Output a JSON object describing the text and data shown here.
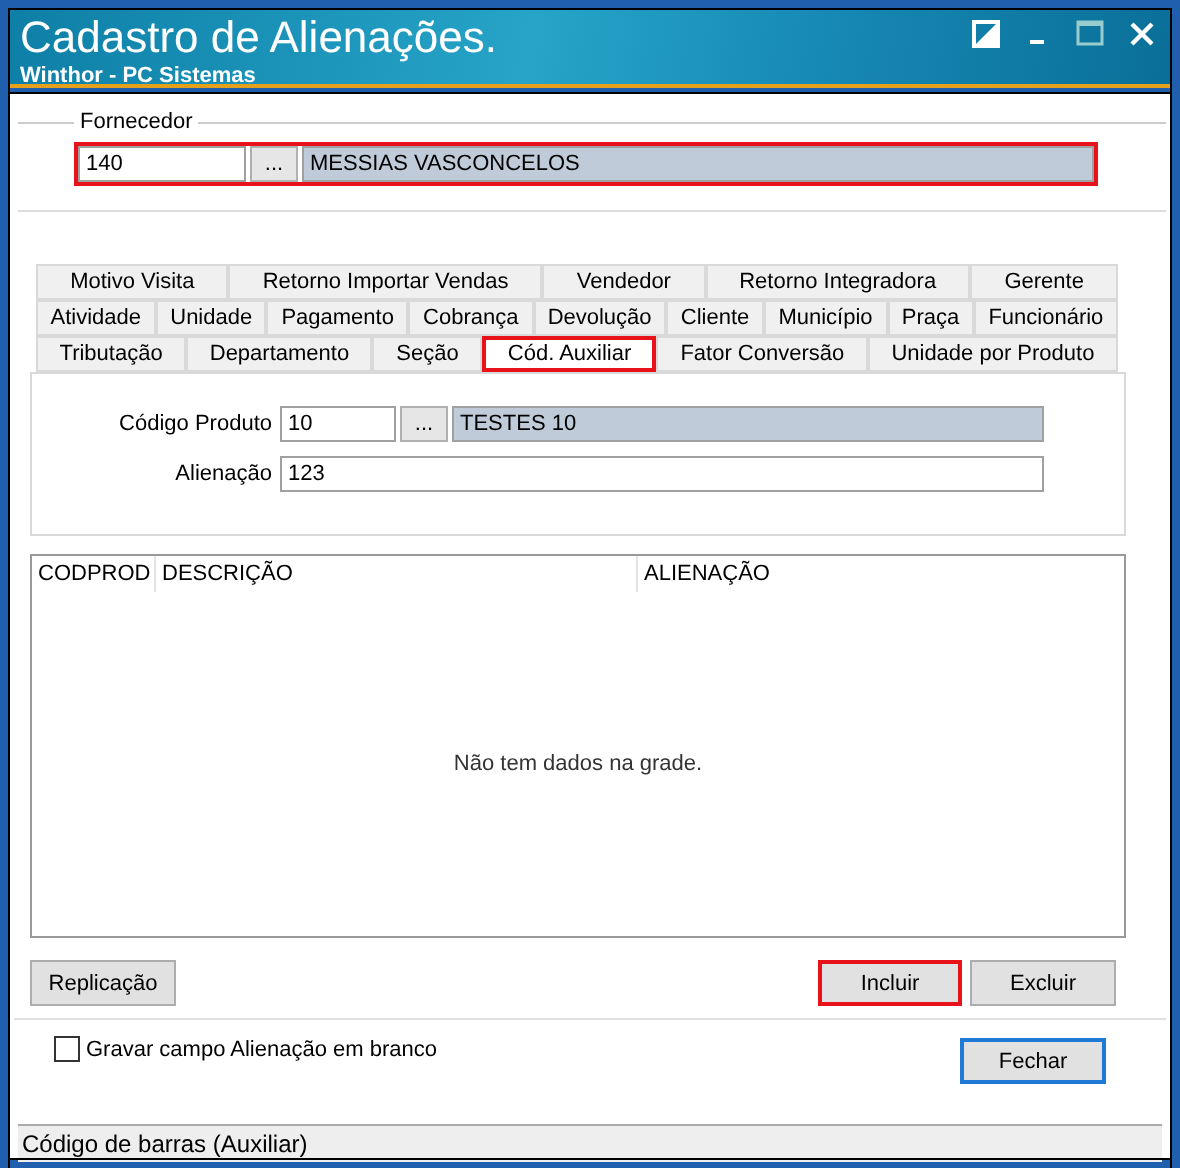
{
  "window": {
    "title": "Cadastro de Alienações.",
    "subtitle": "Winthor - PC Sistemas"
  },
  "fornecedor": {
    "label": "Fornecedor",
    "code": "140",
    "lookup": "...",
    "name": "MESSIAS VASCONCELOS",
    "highlighted": true
  },
  "tab_rows": [
    [
      {
        "label": "Motivo Visita",
        "selected": false
      },
      {
        "label": "Retorno Importar Vendas",
        "selected": false
      },
      {
        "label": "Vendedor",
        "selected": false
      },
      {
        "label": "Retorno Integradora",
        "selected": false
      },
      {
        "label": "Gerente",
        "selected": false
      }
    ],
    [
      {
        "label": "Atividade",
        "selected": false
      },
      {
        "label": "Unidade",
        "selected": false
      },
      {
        "label": "Pagamento",
        "selected": false
      },
      {
        "label": "Cobrança",
        "selected": false
      },
      {
        "label": "Devolução",
        "selected": false
      },
      {
        "label": "Cliente",
        "selected": false
      },
      {
        "label": "Município",
        "selected": false
      },
      {
        "label": "Praça",
        "selected": false
      },
      {
        "label": "Funcionário",
        "selected": false
      }
    ],
    [
      {
        "label": "Tributação",
        "selected": false
      },
      {
        "label": "Departamento",
        "selected": false
      },
      {
        "label": "Seção",
        "selected": false
      },
      {
        "label": "Cód. Auxiliar",
        "selected": true,
        "highlighted": true
      },
      {
        "label": "Fator Conversão",
        "selected": false
      },
      {
        "label": "Unidade por Produto",
        "selected": false
      }
    ]
  ],
  "produto": {
    "label": "Código Produto",
    "code": "10",
    "lookup": "...",
    "name": "TESTES 10"
  },
  "alienacao": {
    "label": "Alienação",
    "value": "123"
  },
  "table": {
    "columns": [
      "CODPROD",
      "DESCRIÇÃO",
      "ALIENAÇÃO"
    ],
    "empty_message": "Não tem dados na grade."
  },
  "buttons": [
    {
      "label": "Replicação",
      "highlighted": false
    },
    {
      "label": "Incluir",
      "highlighted": true
    },
    {
      "label": "Excluir",
      "highlighted": false
    }
  ],
  "checkbox": {
    "label": "Gravar campo Alienação em branco",
    "checked": false
  },
  "close_button": {
    "label": "Fechar",
    "focused": true
  },
  "status_bar": "Código de barras (Auxiliar)"
}
